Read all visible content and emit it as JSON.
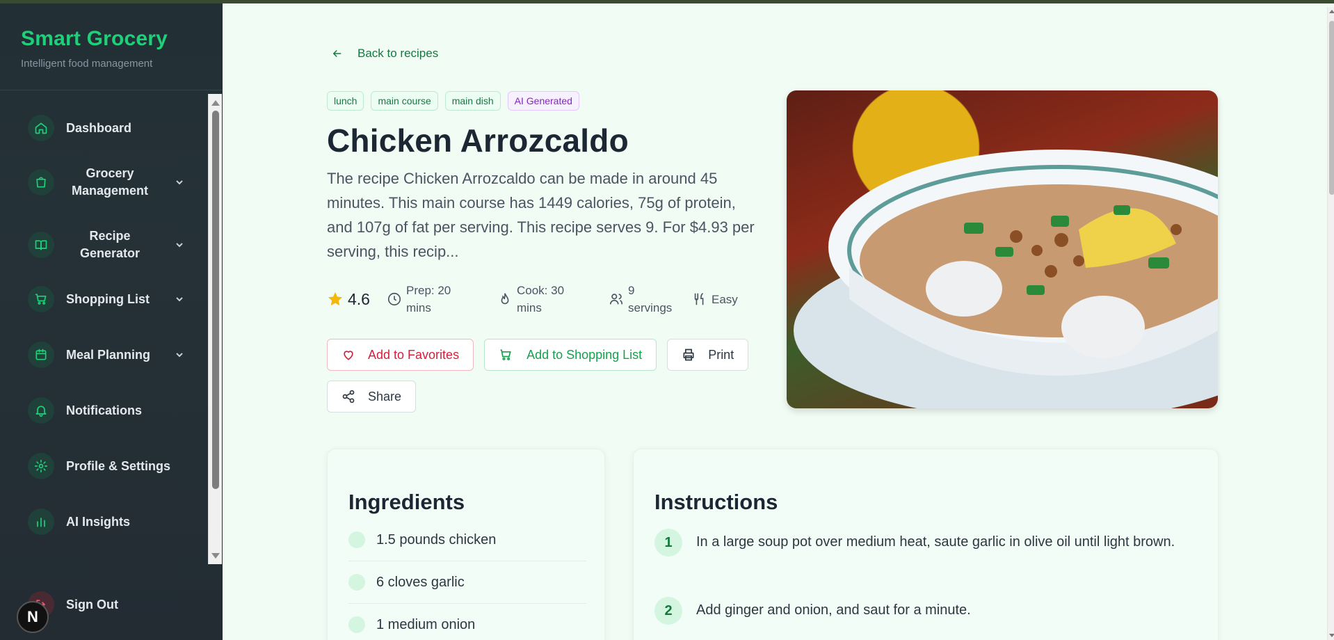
{
  "sidebar": {
    "brand_title": "Smart Grocery",
    "brand_subtitle": "Intelligent food management",
    "items": [
      {
        "label": "Dashboard",
        "icon": "home-icon"
      },
      {
        "label": "Grocery Management",
        "icon": "shopping-bag-icon"
      },
      {
        "label": "Recipe Generator",
        "icon": "book-icon"
      },
      {
        "label": "Shopping List",
        "icon": "cart-icon"
      },
      {
        "label": "Meal Planning",
        "icon": "calendar-icon"
      },
      {
        "label": "Notifications",
        "icon": "bell-icon"
      },
      {
        "label": "Profile & Settings",
        "icon": "gear-icon"
      },
      {
        "label": "AI Insights",
        "icon": "bar-chart-icon"
      }
    ],
    "sign_out": "Sign Out",
    "next_badge": "N"
  },
  "recipe": {
    "back_label": "Back to recipes",
    "tags": [
      "lunch",
      "main course",
      "main dish",
      "AI Generated"
    ],
    "title": "Chicken Arrozcaldo",
    "description": "The recipe Chicken Arrozcaldo can be made in around 45 minutes. This main course has 1449 calories, 75g of protein, and 107g of fat per serving. This recipe serves 9. For $4.93 per serving, this recip...",
    "rating": "4.6",
    "prep": "Prep: 20 mins",
    "cook": "Cook: 30 mins",
    "servings": "9 servings",
    "difficulty": "Easy",
    "actions": {
      "favorites": "Add to Favorites",
      "shopping_list": "Add to Shopping List",
      "print": "Print",
      "share": "Share"
    }
  },
  "ingredients": {
    "title": "Ingredients",
    "items": [
      "1.5 pounds chicken",
      "6 cloves garlic",
      "1 medium onion"
    ]
  },
  "instructions": {
    "title": "Instructions",
    "steps": [
      {
        "num": "1",
        "text": "In a large soup pot over medium heat, saute garlic in olive oil until light brown."
      },
      {
        "num": "2",
        "text": "Add ginger and onion, and saut for a minute."
      }
    ]
  },
  "colors": {
    "accent": "#1fd07a",
    "sidebar_bg": "#243037",
    "main_bg": "#f1fcf5",
    "favorite": "#d2203c",
    "ai_tag": "#8a22c9"
  }
}
